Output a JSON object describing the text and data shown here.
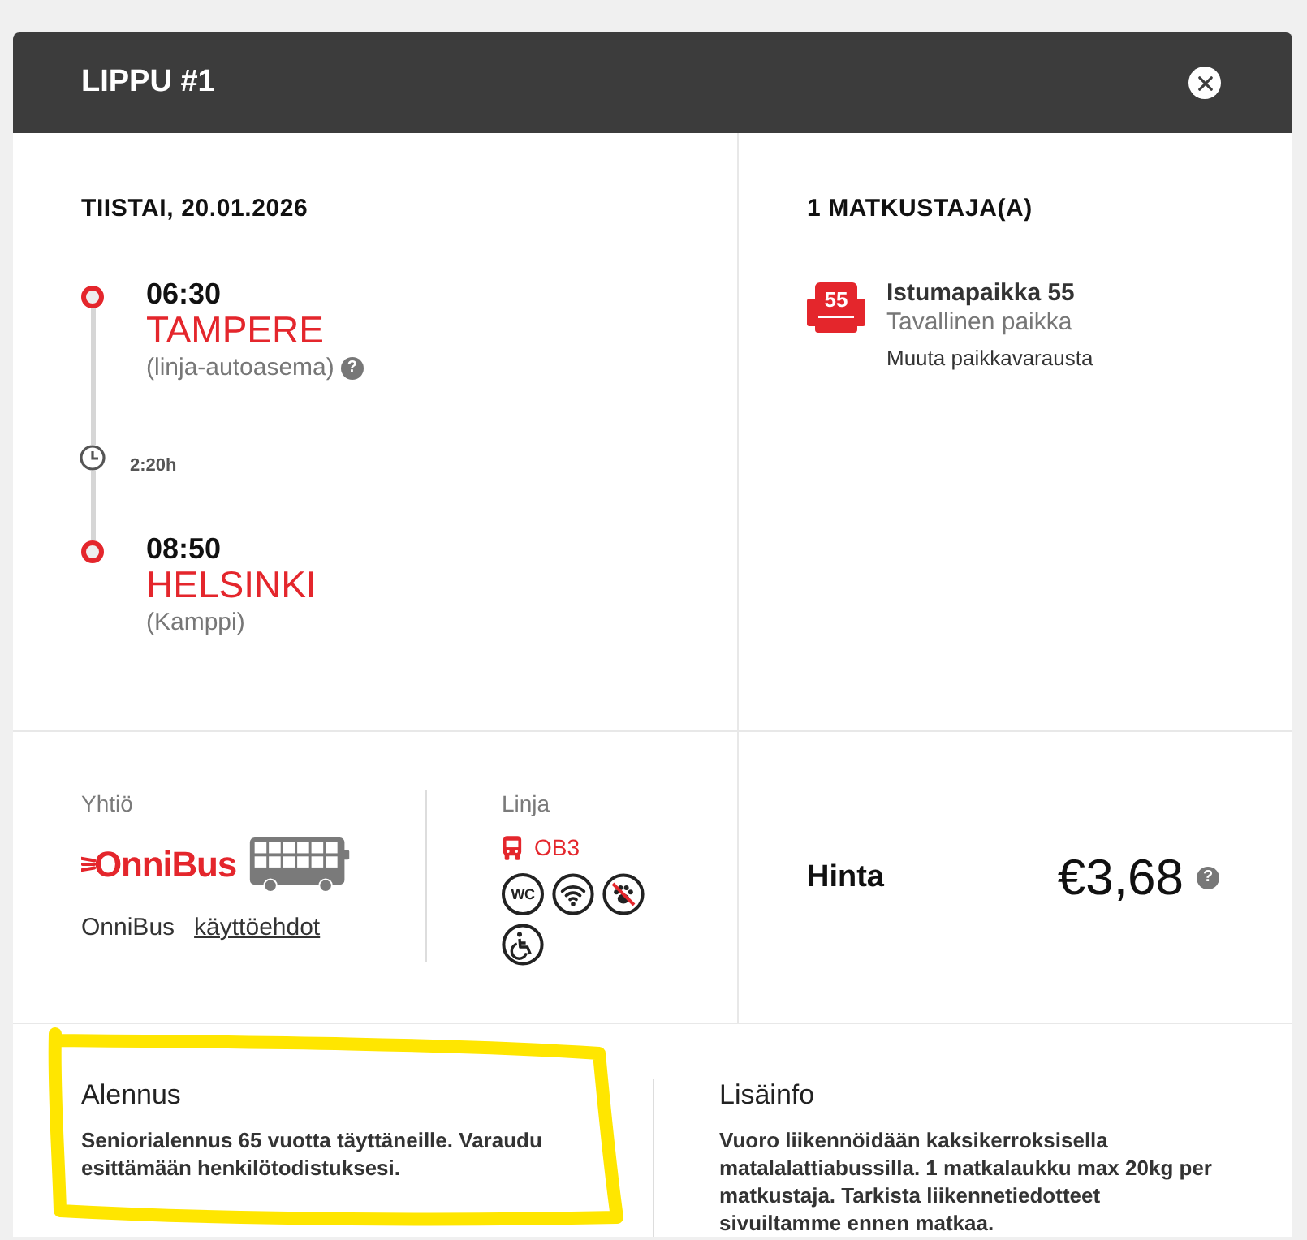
{
  "window": {
    "title": "LIPPU #1"
  },
  "trip": {
    "date": "TIISTAI, 20.01.2026",
    "duration": "2:20h",
    "stops": [
      {
        "time": "06:30",
        "city": "TAMPERE",
        "station": "(linja-autoasema)",
        "help": "?"
      },
      {
        "time": "08:50",
        "city": "HELSINKI",
        "station": "(Kamppi)"
      }
    ]
  },
  "passengers": {
    "heading": "1 MATKUSTAJA(A)",
    "seat": {
      "number": "55",
      "title": "Istumapaikka 55",
      "type": "Tavallinen paikka",
      "link": "Muuta paikkavarausta"
    }
  },
  "company": {
    "label": "Yhtiö",
    "logo": "OnniBus",
    "name": "OnniBus",
    "terms_link": "käyttöehdot"
  },
  "line": {
    "label": "Linja",
    "code": "OB3",
    "amenities": [
      {
        "kind": "wc",
        "label": "WC"
      },
      {
        "kind": "wifi"
      },
      {
        "kind": "no-pets"
      },
      {
        "kind": "wheelchair"
      }
    ]
  },
  "price": {
    "label": "Hinta",
    "amount": "€3,68",
    "help": "?"
  },
  "discount": {
    "title": "Alennus",
    "text": "Seniorialennus 65 vuotta täyttäneille. Varaudu esittämään henkilötodistuksesi.",
    "highlighted": true
  },
  "info": {
    "title": "Lisäinfo",
    "text": "Vuoro liikennöidään kaksikerroksisella matalalattiabussilla. 1 matkalaukku max 20kg per matkustaja. Tarkista liikennetiedotteet sivuiltamme ennen matkaa."
  }
}
